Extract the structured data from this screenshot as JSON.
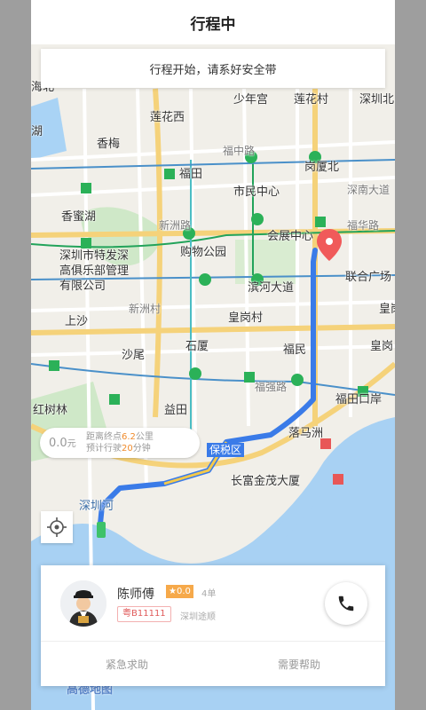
{
  "header": {
    "title": "行程中"
  },
  "notice": {
    "text": "行程开始，请系好安全带"
  },
  "map_labels": [
    "少年宫",
    "莲花村",
    "深圳北",
    "莲花西",
    "香梅",
    "福中路",
    "福田",
    "岗厦北",
    "深南大道",
    "市民中心",
    "香蜜湖",
    "新洲路",
    "会展中心",
    "福华路",
    "购物公园",
    "深圳市特发深",
    "高俱乐部管理",
    "有限公司",
    "滨河大道",
    "联合广场",
    "皇岗",
    "新洲村",
    "上沙",
    "皇岗村",
    "石厦",
    "福民",
    "沙尾",
    "皇岗",
    "福强路",
    "福田口岸",
    "益田",
    "红树林",
    "落马洲",
    "保税区",
    "长富金茂大厦",
    "深圳河",
    "海北",
    "湖"
  ],
  "eta": {
    "cost": "0.0",
    "cost_unit": "元",
    "distance_prefix": "距离终点",
    "distance_value": "6.2",
    "distance_unit": "公里",
    "time_prefix": "预计行驶",
    "time_value": "20",
    "time_unit": "分钟"
  },
  "driver": {
    "name": "陈师傅",
    "rating": "★0.0",
    "orders": "4单",
    "plate": "粤B11111",
    "company": "深圳途顺"
  },
  "actions": {
    "emergency": "紧急求助",
    "help": "需要帮助"
  },
  "watermark": "高德地图",
  "colors": {
    "route": "#3a7be8",
    "metro_green": "#22a35a",
    "expressway": "#f5c94a",
    "river": "#9ecbf2"
  }
}
